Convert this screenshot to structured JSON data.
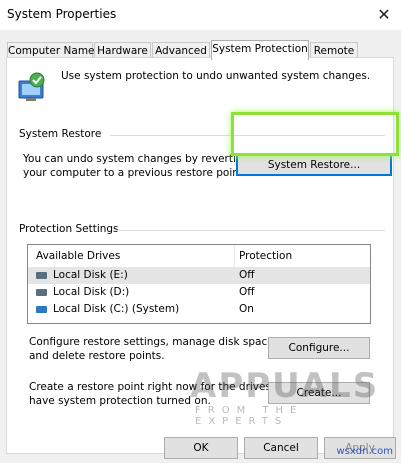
{
  "window": {
    "title": "System Properties",
    "close_glyph": "✕"
  },
  "tabs": [
    {
      "label": "Computer Name"
    },
    {
      "label": "Hardware"
    },
    {
      "label": "Advanced"
    },
    {
      "label": "System Protection",
      "active": true
    },
    {
      "label": "Remote"
    }
  ],
  "intro": {
    "text": "Use system protection to undo unwanted system changes.",
    "icon": "system-protection-icon"
  },
  "system_restore": {
    "heading": "System Restore",
    "description_line1": "You can undo system changes by reverting",
    "description_line2": "your computer to a previous restore point.",
    "button": "System Restore...",
    "highlight_color": "#8ee03a"
  },
  "protection": {
    "heading": "Protection Settings",
    "columns": [
      "Available Drives",
      "Protection"
    ],
    "drives": [
      {
        "name": "Local Disk (E:)",
        "protection": "Off",
        "icon": "drive-icon"
      },
      {
        "name": "Local Disk (D:)",
        "protection": "Off",
        "icon": "drive-icon"
      },
      {
        "name": "Local Disk (C:) (System)",
        "protection": "On",
        "icon": "system-drive-icon"
      }
    ],
    "configure_line1": "Configure restore settings, manage disk space,",
    "configure_line2": "and delete restore points.",
    "configure_button": "Configure...",
    "create_line1": "Create a restore point right now for the drives that",
    "create_line2": "have system protection turned on.",
    "create_button": "Create..."
  },
  "footer": {
    "ok": "OK",
    "cancel": "Cancel",
    "apply": "Apply"
  },
  "watermark": {
    "brand": "APPUALS",
    "tagline": "FROM THE EXPERTS",
    "site": "wsxdn.com"
  }
}
